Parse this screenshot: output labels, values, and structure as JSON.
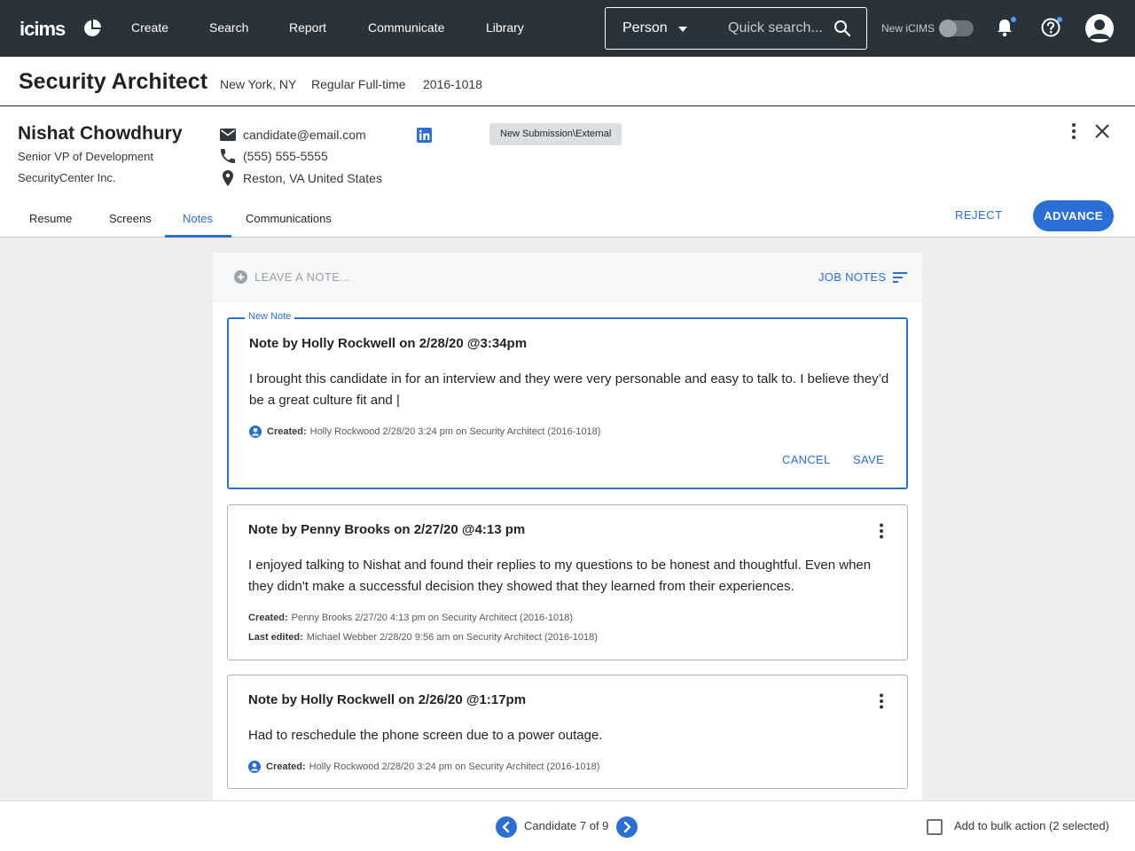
{
  "topbar": {
    "logo": "icims",
    "nav": [
      "Create",
      "Search",
      "Report",
      "Communicate",
      "Library"
    ],
    "search": {
      "select_value": "Person",
      "placeholder": "Quick search..."
    },
    "new_icims_label": "New iCIMS"
  },
  "job": {
    "title": "Security Architect",
    "location": "New York, NY",
    "type": "Regular Full-time",
    "id": "2016-1018"
  },
  "candidate": {
    "name": "Nishat Chowdhury",
    "position": "Senior VP of Development",
    "company": "SecurityCenter Inc.",
    "email": "candidate@email.com",
    "phone": "(555) 555-5555",
    "location": "Reston, VA United States",
    "status": "New Submission\\External"
  },
  "tabs": [
    "Resume",
    "Screens",
    "Notes",
    "Communications"
  ],
  "active_tab": "Notes",
  "actions": {
    "reject": "REJECT",
    "advance": "ADVANCE"
  },
  "notes_panel": {
    "leave_note_placeholder": "LEAVE A NOTE...",
    "job_notes_label": "JOB NOTES"
  },
  "notes": [
    {
      "legend": "New Note",
      "title": "Note by Holly Rockwell on 2/28/20 @3:34pm",
      "body": "I brought this candidate in for an interview and they were very personable and easy to talk to. I believe they’d be a great culture fit and |",
      "created_label": "Created:",
      "created": "Holly Rockwood  2/28/20 3:24 pm on Security Architect (2016-1018)",
      "cancel": "CANCEL",
      "save": "SAVE"
    },
    {
      "title": "Note by Penny Brooks on 2/27/20 @4:13 pm",
      "body": "I enjoyed talking to Nishat and found their replies to my questions to be honest and thoughtful. Even when they didn't make a successful decision they showed that they learned from their experiences.",
      "created_label": "Created:",
      "created": "Penny Brooks  2/27/20 4:13 pm on Security Architect (2016-1018)",
      "edited_label": "Last edited:",
      "edited": "Michael Webber  2/28/20 9:56 am on Security Architect (2016-1018)"
    },
    {
      "title": "Note by Holly Rockwell on 2/26/20 @1:17pm",
      "body": "Had to reschedule the phone screen due to a power outage.",
      "created_label": "Created:",
      "created": "Holly Rockwood  2/28/20 3:24 pm on Security Architect (2016-1018)"
    }
  ],
  "footer": {
    "pager": "Candidate 7 of 9",
    "bulk_label": "Add to bulk action (2 selected)"
  },
  "colors": {
    "accent": "#2b6fd6",
    "topbar": "#2a323a"
  }
}
